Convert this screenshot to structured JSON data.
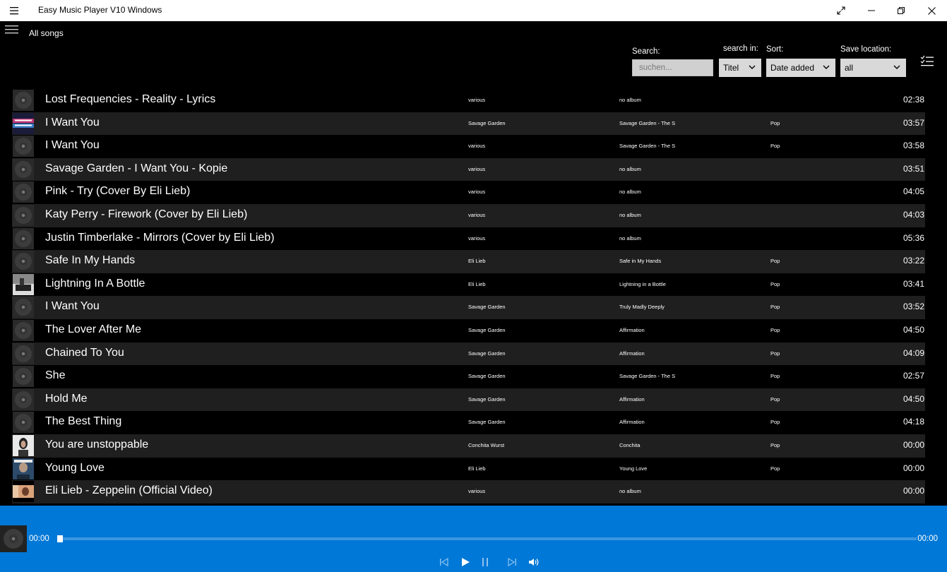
{
  "window": {
    "title": "Easy Music Player V10 Windows"
  },
  "header": {
    "view_title": "All songs"
  },
  "controls": {
    "search_label": "Search:",
    "search_placeholder": "suchen...",
    "search_in_label": "search in:",
    "search_in_value": "Titel",
    "sort_label": "Sort:",
    "sort_value": "Date added",
    "save_location_label": "Save location:",
    "save_location_value": "all"
  },
  "songs": [
    {
      "title": "Lost Frequencies  - Reality - Lyrics",
      "artist": "various",
      "album": "no album",
      "genre": "",
      "duration": "02:38",
      "cover": "disc-icon"
    },
    {
      "title": "I Want You",
      "artist": "Savage Garden",
      "album": "Savage Garden - The S",
      "genre": "Pop",
      "duration": "03:57",
      "cover": "savage-garden-cover"
    },
    {
      "title": "I Want You",
      "artist": "various",
      "album": "Savage Garden - The S",
      "genre": "Pop",
      "duration": "03:58",
      "cover": "disc-icon"
    },
    {
      "title": "Savage Garden - I Want You - Kopie",
      "artist": "various",
      "album": "no album",
      "genre": "",
      "duration": "03:51",
      "cover": "disc-icon"
    },
    {
      "title": "Pink - Try (Cover By Eli Lieb)",
      "artist": "various",
      "album": "no album",
      "genre": "",
      "duration": "04:05",
      "cover": "disc-icon"
    },
    {
      "title": "Katy Perry - Firework (Cover by Eli Lieb)",
      "artist": "various",
      "album": "no album",
      "genre": "",
      "duration": "04:03",
      "cover": "disc-icon"
    },
    {
      "title": "Justin Timberlake - Mirrors (Cover by Eli Lieb)",
      "artist": "various",
      "album": "no album",
      "genre": "",
      "duration": "05:36",
      "cover": "disc-icon"
    },
    {
      "title": "Safe In My Hands",
      "artist": "Eli Lieb",
      "album": "Safe in My Hands",
      "genre": "Pop",
      "duration": "03:22",
      "cover": "disc-icon"
    },
    {
      "title": "Lightning In A Bottle",
      "artist": "Eli Lieb",
      "album": "Lightning in a Bottle",
      "genre": "Pop",
      "duration": "03:41",
      "cover": "piano-cover"
    },
    {
      "title": "I Want You",
      "artist": "Savage Garden",
      "album": "Truly Madly Deeply",
      "genre": "Pop",
      "duration": "03:52",
      "cover": "disc-icon"
    },
    {
      "title": "The Lover After Me",
      "artist": "Savage Garden",
      "album": "Affirmation",
      "genre": "Pop",
      "duration": "04:50",
      "cover": "disc-icon"
    },
    {
      "title": "Chained To You",
      "artist": "Savage Garden",
      "album": "Affirmation",
      "genre": "Pop",
      "duration": "04:09",
      "cover": "disc-icon"
    },
    {
      "title": "She",
      "artist": "Savage Garden",
      "album": "Savage Garden - The S",
      "genre": "Pop",
      "duration": "02:57",
      "cover": "disc-icon"
    },
    {
      "title": "Hold Me",
      "artist": "Savage Garden",
      "album": "Affirmation",
      "genre": "Pop",
      "duration": "04:50",
      "cover": "disc-icon"
    },
    {
      "title": "The Best Thing",
      "artist": "Savage Garden",
      "album": "Affirmation",
      "genre": "Pop",
      "duration": "04:18",
      "cover": "disc-icon"
    },
    {
      "title": "You are unstoppable",
      "artist": "Conchita Wurst",
      "album": "Conchita",
      "genre": "Pop",
      "duration": "00:00",
      "cover": "portrait-cover"
    },
    {
      "title": "Young Love",
      "artist": "Eli Lieb",
      "album": "Young Love",
      "genre": "Pop",
      "duration": "00:00",
      "cover": "young-love-cover"
    },
    {
      "title": "Eli Lieb - Zeppelin (Official Video)",
      "artist": "various",
      "album": "no album",
      "genre": "",
      "duration": "00:00",
      "cover": "video-cover"
    }
  ],
  "player": {
    "current_time": "00:00",
    "total_time": "00:00",
    "progress": 0
  },
  "colors": {
    "accent": "#0078d7",
    "row_alt": "#1f1f1f",
    "background": "#000000"
  }
}
